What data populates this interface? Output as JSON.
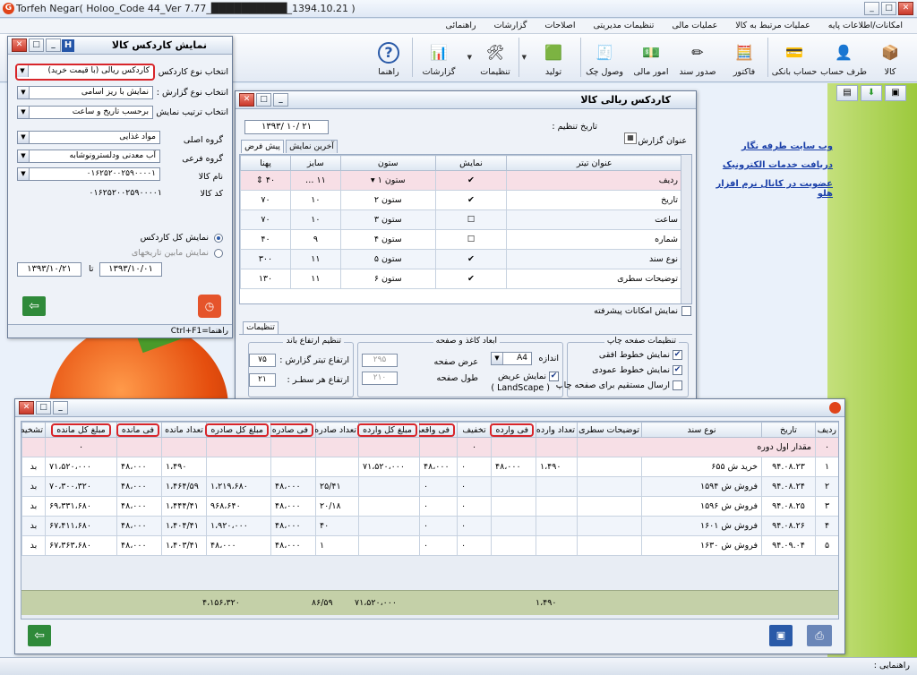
{
  "app": {
    "title": "Torfeh Negar( Holoo_Code 44_Ver 7.77_██████████_1394.10.21 )"
  },
  "menu": [
    "امکانات/اطلاعات پایه",
    "عملیات مرتبط به کالا",
    "عملیات مالی",
    "تنظیمات مدیریتی",
    "اصلاحات",
    "گزارشات",
    "راهنمائی"
  ],
  "toolbar": [
    {
      "label": "کالا",
      "icon": "box-icon",
      "glyph": "📦"
    },
    {
      "label": "طرف حساب",
      "icon": "user-icon",
      "glyph": "👤"
    },
    {
      "label": "حساب بانکی",
      "icon": "bank-card-icon",
      "glyph": "💳"
    },
    {
      "label": "فاکتور",
      "icon": "calculator-icon",
      "glyph": "🧮"
    },
    {
      "label": "صدور سند",
      "icon": "pencil-icon",
      "glyph": "✏"
    },
    {
      "label": "امور مالی",
      "icon": "money-icon",
      "glyph": "💵"
    },
    {
      "label": "وصول چک",
      "icon": "check-icon",
      "glyph": "🧾"
    },
    {
      "label": "تولید",
      "icon": "cube-icon",
      "glyph": "🟩"
    },
    {
      "label": "تنظیمات",
      "icon": "tools-icon",
      "glyph": "🛠"
    },
    {
      "label": "گزارشات",
      "icon": "chart-icon",
      "glyph": "📊"
    },
    {
      "label": "راهنما",
      "icon": "help-icon",
      "glyph": "?"
    }
  ],
  "side_links": [
    "وب سایت طرفه نگار",
    "دریافت خدمات الکترونیک",
    "عضویت در کانال نرم افزار هلو"
  ],
  "left_dialog": {
    "title": "نمایش کاردکس کالا",
    "rows": [
      {
        "label": "انتخاب نوع کاردکس :",
        "value": "کاردکس ریالی (با قیمت خرید)"
      },
      {
        "label": "انتخاب نوع گزارش :",
        "value": "نمایش با ریز اسامی"
      },
      {
        "label": "انتخاب ترتیب نمایش :",
        "value": "برحسب تاریخ و ساعت"
      },
      {
        "label": "گروه اصلی",
        "value": "مواد غذایی"
      },
      {
        "label": "گروه فرعی",
        "value": "آب معدنی ودلسترونوشابه"
      },
      {
        "label": "نام کالا",
        "value": "۰۱۶۲۵۲۰۰۲۵۹۰۰۰۰۱"
      },
      {
        "label": "کد کالا",
        "value": "۰۱۶۲۵۲۰۰۲۵۹۰۰۰۰۱"
      }
    ],
    "radio_all": "نمایش کل کاردکس",
    "radio_range": "نمایش مابین تاریخهای",
    "date_from": "۱۳۹۳/۱۰/۰۱",
    "date_to": "۱۳۹۳/۱۰/۲۱",
    "date_sep": "تا",
    "help": "راهنما=Ctrl+F1"
  },
  "mid_dialog": {
    "title": "کاردکس ریالی کالا",
    "date_label": "تاریخ تنظیم :",
    "date_value": "۱۳۹۳/ ۱۰/ ۲۱",
    "report_title_label": "عنوان گزارش :",
    "tabs": [
      "پیش فرض",
      "آخرین نمایش"
    ],
    "headers": [
      "عنوان تیتر",
      "نمایش",
      "ستون",
      "سایز",
      "پهنا"
    ],
    "rows": [
      {
        "title": "ردیف",
        "show": true,
        "col": "ستون ۱",
        "size": "۱۱",
        "width": "۴۰"
      },
      {
        "title": "تاریخ",
        "show": true,
        "col": "ستون ۲",
        "size": "۱۰",
        "width": "۷۰"
      },
      {
        "title": "ساعت",
        "show": false,
        "col": "ستون ۳",
        "size": "۱۰",
        "width": "۷۰"
      },
      {
        "title": "شماره",
        "show": false,
        "col": "ستون ۴",
        "size": "۹",
        "width": "۴۰"
      },
      {
        "title": "نوع سند",
        "show": true,
        "col": "ستون ۵",
        "size": "۱۱",
        "width": "۳۰۰"
      },
      {
        "title": "توضیحات سطری",
        "show": true,
        "col": "ستون ۶",
        "size": "۱۱",
        "width": "۱۳۰"
      }
    ],
    "advanced": "نمایش امکانات پیشرفته",
    "settings_tab": "تنظیمات",
    "print_group": "تنظیمات صفحه چاپ",
    "print_opts": [
      "نمایش خطوط افقی",
      "نمایش خطوط عمودی",
      "ارسال مستقیم برای صفحه چاپ"
    ],
    "paper_group": "ابعاد کاغذ و صفحه",
    "paper_size_label": "اندازه",
    "paper_size": "A4",
    "landscape": "نمایش عریض",
    "landscape2": "( LandScape )",
    "page_width_label": "عرض صفحه",
    "page_width": "۲۹۵",
    "page_height_label": "طول صفحه",
    "page_height": "۲۱۰",
    "height_group": "تنظیم ارتفاع باند",
    "header_h_label": "ارتفاع تیتر گزارش :",
    "header_h": "۷۵",
    "row_h_label": "ارتفاع هر سطـر :",
    "row_h": "۲۱"
  },
  "kardex": {
    "headers": [
      "ردیف",
      "تاریخ",
      "نوع سند",
      "توضیحات سطری",
      "تعداد وارده",
      "فی وارده",
      "تخفیف",
      "فی واقعی",
      "مبلغ کل وارده",
      "تعداد صادره",
      "فی صادره",
      "مبلغ کل صادره",
      "تعداد مانده",
      "فی مانده",
      "مبلغ کل مانده",
      "تشخیص"
    ],
    "opening": {
      "label": "مقدار اول دوره",
      "mark1": "۰",
      "mark2": "۰"
    },
    "rows": [
      {
        "n": "۱",
        "date": "۹۴.۰۸.۲۳",
        "doc": "خرید ش ۶۵۵",
        "desc": "",
        "in_qty": "۱،۴۹۰",
        "in_fee": "۴۸،۰۰۰",
        "disc": "۰",
        "real_fee": "۴۸،۰۰۰",
        "in_total": "۷۱،۵۲۰،۰۰۰",
        "out_qty": "",
        "out_fee": "",
        "out_total": "",
        "rem_qty": "۱،۴۹۰",
        "rem_fee": "۴۸،۰۰۰",
        "rem_total": "۷۱،۵۲۰،۰۰۰",
        "flag": "بد"
      },
      {
        "n": "۲",
        "date": "۹۴.۰۸.۲۴",
        "doc": "فروش ش ۱۵۹۴",
        "desc": "",
        "in_qty": "",
        "in_fee": "",
        "disc": "۰",
        "real_fee": "۰",
        "in_total": "",
        "out_qty": "۲۵/۴۱",
        "out_fee": "۴۸،۰۰۰",
        "out_total": "۱،۲۱۹،۶۸۰",
        "rem_qty": "۱،۴۶۴/۵۹",
        "rem_fee": "۴۸،۰۰۰",
        "rem_total": "۷۰،۳۰۰،۳۲۰",
        "flag": "بد"
      },
      {
        "n": "۳",
        "date": "۹۴.۰۸.۲۵",
        "doc": "فروش ش ۱۵۹۶",
        "desc": "",
        "in_qty": "",
        "in_fee": "",
        "disc": "۰",
        "real_fee": "۰",
        "in_total": "",
        "out_qty": "۲۰/۱۸",
        "out_fee": "۴۸،۰۰۰",
        "out_total": "۹۶۸،۶۴۰",
        "rem_qty": "۱،۴۴۴/۴۱",
        "rem_fee": "۴۸،۰۰۰",
        "rem_total": "۶۹،۳۳۱،۶۸۰",
        "flag": "بد"
      },
      {
        "n": "۴",
        "date": "۹۴.۰۸.۲۶",
        "doc": "فروش ش ۱۶۰۱",
        "desc": "",
        "in_qty": "",
        "in_fee": "",
        "disc": "۰",
        "real_fee": "۰",
        "in_total": "",
        "out_qty": "۴۰",
        "out_fee": "۴۸،۰۰۰",
        "out_total": "۱،۹۲۰،۰۰۰",
        "rem_qty": "۱،۴۰۴/۴۱",
        "rem_fee": "۴۸،۰۰۰",
        "rem_total": "۶۷،۴۱۱،۶۸۰",
        "flag": "بد"
      },
      {
        "n": "۵",
        "date": "۹۴.۰۹.۰۴",
        "doc": "فروش ش ۱۶۳۰",
        "desc": "",
        "in_qty": "",
        "in_fee": "",
        "disc": "۰",
        "real_fee": "۰",
        "in_total": "",
        "out_qty": "۱",
        "out_fee": "۴۸،۰۰۰",
        "out_total": "۴۸،۰۰۰",
        "rem_qty": "۱،۴۰۳/۴۱",
        "rem_fee": "۴۸،۰۰۰",
        "rem_total": "۶۷،۳۶۳،۶۸۰",
        "flag": "بد"
      }
    ],
    "totals": {
      "in_qty": "۱،۴۹۰",
      "in_total": "۷۱،۵۲۰،۰۰۰",
      "out_qty": "۸۶/۵۹",
      "out_total": "۴،۱۵۶،۳۲۰"
    }
  },
  "status": "راهنمایی :",
  "colors": {
    "highlight": "#d8252a",
    "link": "#1a3fa8"
  }
}
